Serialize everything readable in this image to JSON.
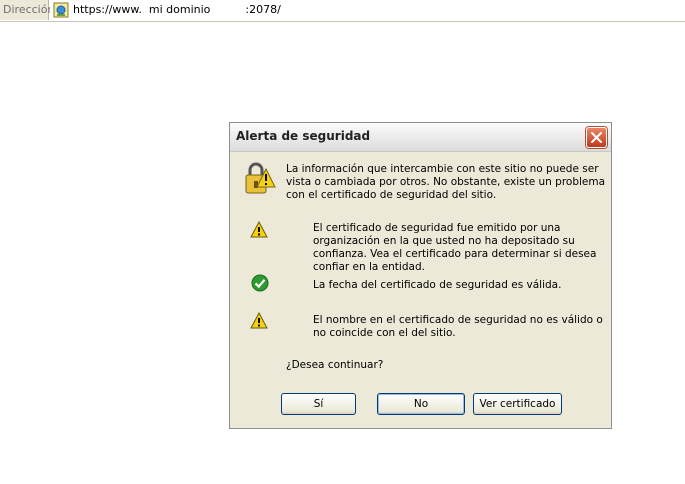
{
  "address_bar": {
    "label": "Dirección",
    "url": "https://www.  mi dominio          :2078/"
  },
  "dialog": {
    "title": "Alerta de seguridad",
    "main_message": "La información que intercambie con este sitio no puede ser vista o cambiada por otros. No obstante, existe un problema con el certificado de seguridad del sitio.",
    "items": [
      {
        "status": "warning",
        "icon": "warning-icon",
        "text": "El certificado de seguridad fue emitido por una organización en la que usted no ha depositado su confianza. Vea el certificado para determinar si desea confiar en la entidad."
      },
      {
        "status": "ok",
        "icon": "check-icon",
        "text": "La fecha del certificado de seguridad es válida."
      },
      {
        "status": "warning",
        "icon": "warning-icon",
        "text": "El nombre en el certificado de seguridad no es válido o no coincide con el del sitio."
      }
    ],
    "question": "¿Desea continuar?",
    "buttons": {
      "yes": "Sí",
      "no": "No",
      "view_certificate": "Ver certificado"
    }
  },
  "colors": {
    "warning": "#f5d10f",
    "ok": "#2f9a2f",
    "close": "#c0391f",
    "focus_border": "#003c74"
  }
}
